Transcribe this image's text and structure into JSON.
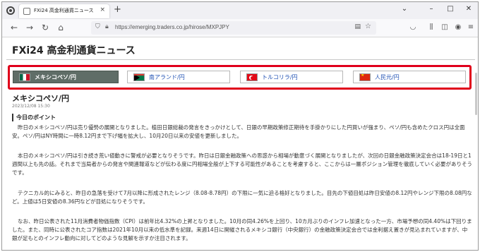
{
  "browser": {
    "tab_title": "FXi24 高金利通貨ニュース",
    "tab_close": "×",
    "new_tab": "+",
    "url": "https://emerging.traders.co.jp/hirose/MXPJPY",
    "window_controls": {
      "dropdown": "⌄",
      "minimize": "–",
      "maximize": "□",
      "close": "✕"
    }
  },
  "page": {
    "site_title": "FXi24 高金利通貨ニュース",
    "currency_tabs": [
      {
        "label": "メキシコペソ/円",
        "flag": "mexico-flag",
        "active": true
      },
      {
        "label": "南アランド/円",
        "flag": "south-africa-flag",
        "active": false
      },
      {
        "label": "トルコリラ/円",
        "flag": "turkey-flag",
        "active": false
      },
      {
        "label": "人民元/円",
        "flag": "china-flag",
        "active": false
      }
    ],
    "article": {
      "title": "メキシコペソ/円",
      "date": "2023/12/08 15:30",
      "section_heading": "今日のポイント",
      "paragraphs": [
        "昨日のメキシコペソ/円は売り優勢の展開となりました。植田日銀総裁の発言をきっかけとして、日銀の早期政策修正期待を手掛かりにした円買いが強まり、ペソ/円も含めたクロス円は全面安。ペソ/円はNY時間に一時8.12円まで下げ幅を拡大し、10月20日以来の安値を更新しました。",
        "本日のメキシコペソ/円は引き続き荒い値動きに警戒が必要となりそうです。昨日は日銀金融政策への思惑から相場が動意づく展開となりましたが、次回の日銀金融政策決定会合は18-19日と1週間以上も先の話。それまで当局者からの発言や関連報道などが伝わる度に円相場全般が上下する可能性があることを考慮すると、ここからは一層ポジション管理を徹底していく必要がありそうです。",
        "テクニカル的にみると、昨日の急落を受けて7月以降に形成されたレンジ（8.08-8.78円）の下限に一気に迫る格好となりました。目先の下値目処は昨日安値の8.12円やレンジ下限の8.08円など。上値は5日安値の8.36円などが目処になりそうです。",
        "なお、昨日公表された11月消費者物価指数（CPI）は前年比4.32%の上昇となりました。10月の同4.26%を上回り、10カ月ぶりのインフレ加速となった一方、市場予想の同4.40%は下回りました。また、同時に公表されたコア指数は2021年10月以来の低水準を記録。来週14日に開催されるメキシコ銀行（中央銀行）の金融政策決定会合では金利据え置きが見込まれていますが、中銀が足もとのインフレ動向に対してどのような見解を示すか注目されます。"
      ]
    }
  },
  "colors": {
    "highlight_border": "#e0001b",
    "active_tab_bg": "#5f6d67",
    "link_text": "#1d4fb3"
  }
}
